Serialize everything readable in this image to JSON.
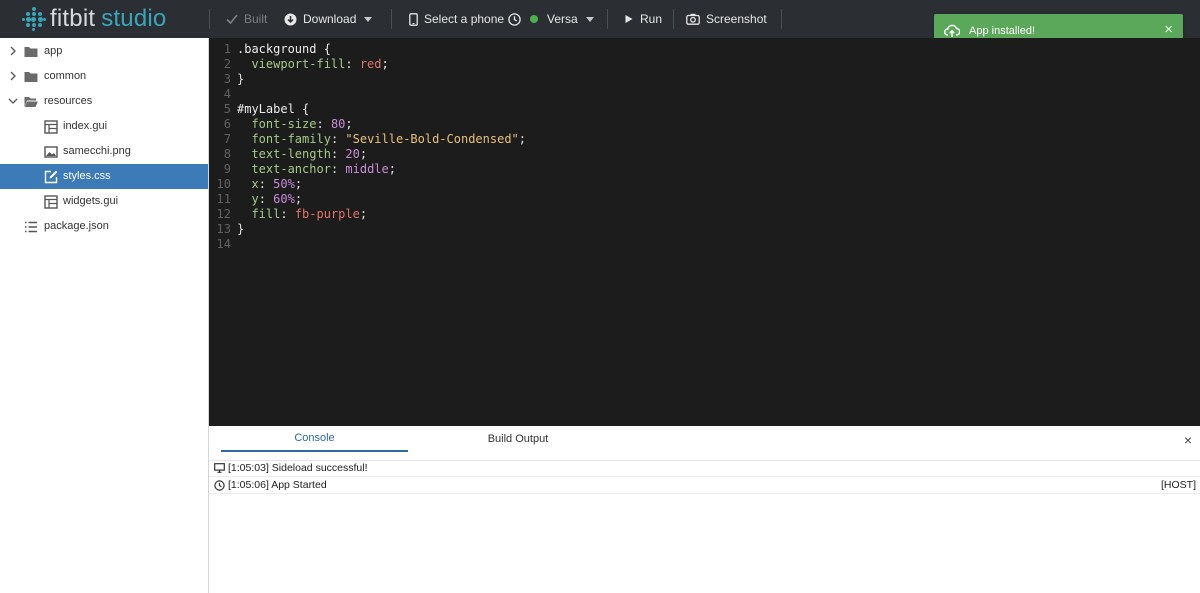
{
  "app": {
    "logo_word_a": "fitbit",
    "logo_word_b": "studio",
    "accent_color": "#3aa5b8"
  },
  "toolbar": {
    "built_label": "Built",
    "download_label": "Download",
    "select_phone_label": "Select a phone",
    "device_label": "Versa",
    "run_label": "Run",
    "screenshot_label": "Screenshot"
  },
  "toast": {
    "message": "App installed!",
    "close_symbol": "×",
    "color": "#5ba85a"
  },
  "sidebar": {
    "items": [
      {
        "label": "app",
        "icon": "folder-icon",
        "expandable": "collapsed"
      },
      {
        "label": "common",
        "icon": "folder-icon",
        "expandable": "collapsed"
      },
      {
        "label": "resources",
        "icon": "folder-open-icon",
        "expandable": "expanded"
      },
      {
        "label": "index.gui",
        "icon": "layout-file-icon"
      },
      {
        "label": "samecchi.png",
        "icon": "image-file-icon"
      },
      {
        "label": "styles.css",
        "icon": "edit-file-icon",
        "selected": true
      },
      {
        "label": "widgets.gui",
        "icon": "layout-file-icon"
      },
      {
        "label": "package.json",
        "icon": "list-file-icon"
      }
    ]
  },
  "editor": {
    "file": "styles.css",
    "line_numbers": [
      "1",
      "2",
      "3",
      "4",
      "5",
      "6",
      "7",
      "8",
      "9",
      "10",
      "11",
      "12",
      "13",
      "14"
    ],
    "lines": [
      ".background {",
      "  viewport-fill: red;",
      "}",
      "",
      "#myLabel {",
      "  font-size: 80;",
      "  font-family: \"Seville-Bold-Condensed\";",
      "  text-length: 20;",
      "  text-anchor: middle;",
      "  x: 50%;",
      "  y: 60%;",
      "  fill: fb-purple;",
      "}",
      ""
    ]
  },
  "panel": {
    "tabs": [
      {
        "label": "Console",
        "active": true
      },
      {
        "label": "Build Output",
        "active": false
      }
    ],
    "close_symbol": "×",
    "logs": [
      {
        "icon": "monitor-icon",
        "text": "[1:05:03] Sideload successful!",
        "source": ""
      },
      {
        "icon": "clock-icon",
        "text": "[1:05:06] App Started",
        "source": "[HOST]"
      }
    ]
  }
}
